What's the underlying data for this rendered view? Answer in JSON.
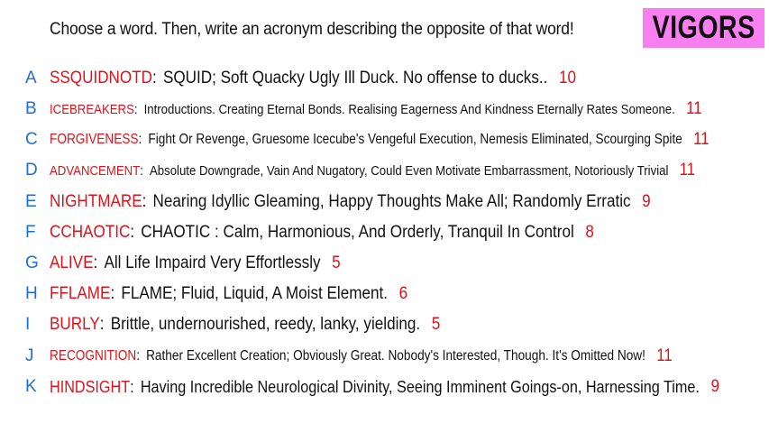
{
  "header": {
    "prompt": "Choose a word. Then, write an acronym describing the opposite of that word!",
    "badge_label": "VIGORS",
    "badge_color": "#f77ff0"
  },
  "colors": {
    "letter": "#1f6fd1",
    "word": "#d9141c",
    "score": "#d9141c",
    "text": "#111111"
  },
  "entries": [
    {
      "letter": "A",
      "word": "SSQUIDNOTD",
      "acronym": "SQUID; Soft Quacky Ugly Ill Duck. No offense to ducks..",
      "score": "10"
    },
    {
      "letter": "B",
      "word": "ICEBREAKERS",
      "acronym": "Introductions. Creating Eternal Bonds. Realising Eagerness And Kindness Eternally Rates Someone.",
      "score": "11"
    },
    {
      "letter": "C",
      "word": "FORGIVENESS",
      "acronym": "Fight Or Revenge, Gruesome Icecube's Vengeful Execution,  Nemesis Eliminated, Scourging Spite",
      "score": "11"
    },
    {
      "letter": "D",
      "word": "ADVANCEMENT",
      "acronym": "Absolute Downgrade, Vain And Nugatory, Could Even Motivate Embarrassment, Notoriously Trivial",
      "score": "11"
    },
    {
      "letter": "E",
      "word": "NIGHTMARE",
      "acronym": "Nearing Idyllic Gleaming, Happy Thoughts Make All; Randomly Erratic",
      "score": "9"
    },
    {
      "letter": "F",
      "word": "CCHAOTIC",
      "acronym": "CHAOTIC : Calm, Harmonious, And Orderly, Tranquil In Control",
      "score": "8"
    },
    {
      "letter": "G",
      "word": "ALIVE",
      "acronym": "All Life Impaird Very Effortlessly",
      "score": "5"
    },
    {
      "letter": "H",
      "word": "FFLAME",
      "acronym": "FLAME; Fluid, Liquid, A Moist Element.",
      "score": "6"
    },
    {
      "letter": "I",
      "word": "BURLY",
      "acronym": "Brittle, undernourished, reedy, lanky, yielding.",
      "score": "5"
    },
    {
      "letter": "J",
      "word": "RECOGNITION",
      "acronym": "Rather Excellent Creation; Obviously Great. Nobody's Interested, Though. It's Omitted Now!",
      "score": "11"
    },
    {
      "letter": "K",
      "word": "HINDSIGHT",
      "acronym": "Having Incredible Neurological Divinity, Seeing Imminent Goings-on, Harnessing Time.",
      "score": "9"
    }
  ]
}
